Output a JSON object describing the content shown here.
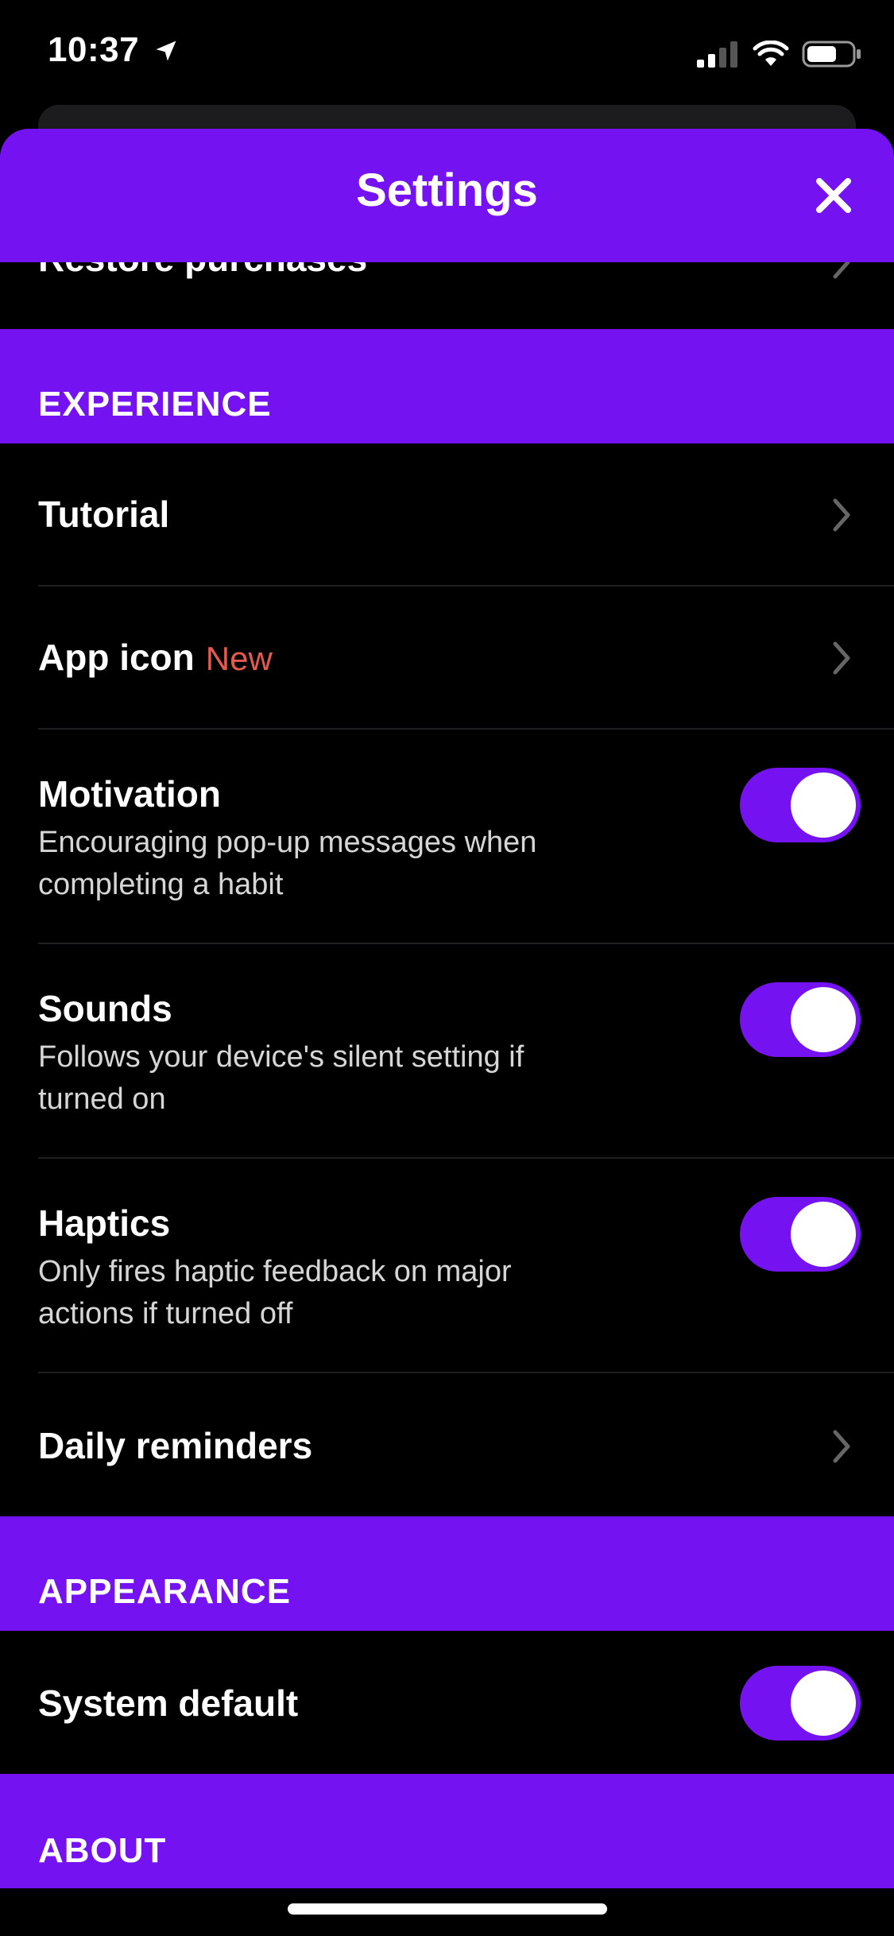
{
  "status_bar": {
    "time": "10:37",
    "icons": [
      "location-arrow-icon",
      "cellular-signal-icon",
      "wifi-icon",
      "battery-icon"
    ]
  },
  "header": {
    "title": "Settings",
    "close_icon": "close-icon"
  },
  "partial_row": {
    "label": "Restore purchases"
  },
  "sections": {
    "experience": {
      "label": "EXPERIENCE",
      "tutorial": {
        "title": "Tutorial"
      },
      "app_icon": {
        "title": "App icon",
        "badge": "New"
      },
      "motivation": {
        "title": "Motivation",
        "desc_line1": "Encouraging pop-up messages when",
        "desc_line2": "completing a habit",
        "enabled": true
      },
      "sounds": {
        "title": "Sounds",
        "desc_line1": "Follows your device's silent setting if",
        "desc_line2": "turned on",
        "enabled": true
      },
      "haptics": {
        "title": "Haptics",
        "desc_line1": "Only fires haptic feedback on major",
        "desc_line2": "actions if turned off",
        "enabled": true
      },
      "daily_reminders": {
        "title": "Daily reminders"
      }
    },
    "appearance": {
      "label": "APPEARANCE",
      "system_default": {
        "title": "System default",
        "enabled": true
      }
    },
    "about": {
      "label": "ABOUT"
    }
  },
  "colors": {
    "accent": "#7412f2",
    "background": "#000000",
    "badge": "#e55a4f"
  }
}
